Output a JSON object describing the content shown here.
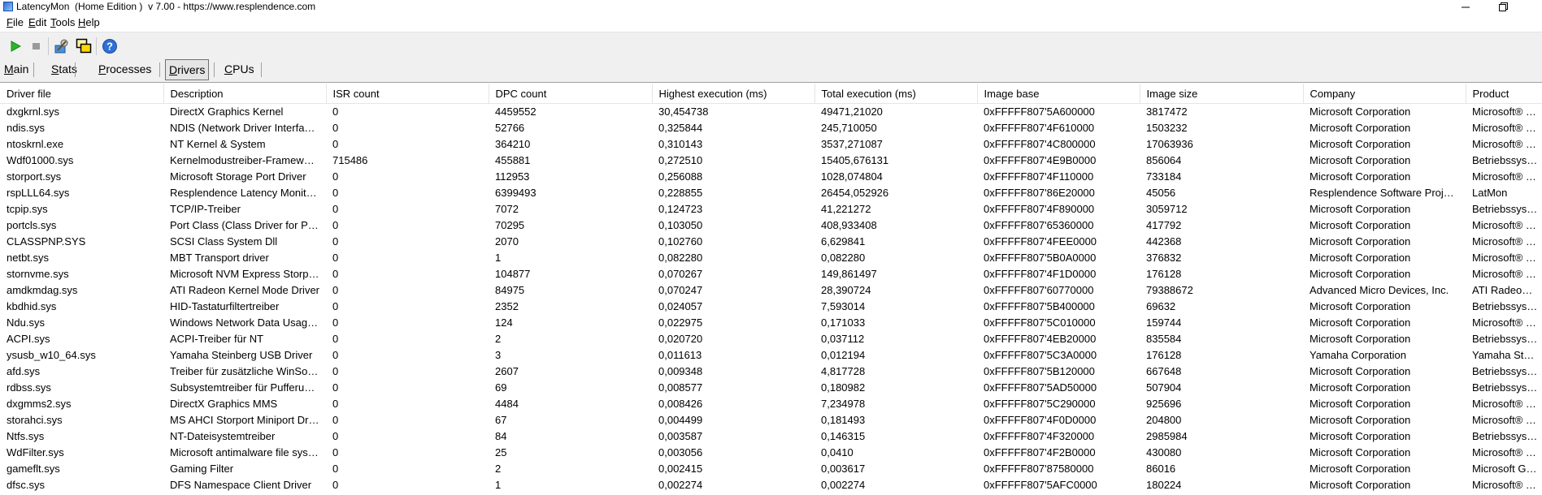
{
  "window": {
    "title": "LatencyMon  (Home Edition )  v 7.00 - https://www.resplendence.com"
  },
  "menu": [
    {
      "label": "File",
      "u": "F",
      "rest": "ile"
    },
    {
      "label": "Edit",
      "u": "E",
      "rest": "dit"
    },
    {
      "label": "Tools",
      "u": "T",
      "rest": "ools"
    },
    {
      "label": "Help",
      "u": "H",
      "rest": "elp"
    }
  ],
  "toolbar": {
    "icons": [
      "play-icon",
      "stop-icon",
      "driver-settings-icon",
      "windows-icon",
      "help-icon"
    ]
  },
  "tabs": [
    {
      "label": "Main",
      "u": "M",
      "rest": "ain",
      "active": false
    },
    {
      "label": "Stats",
      "u": "S",
      "rest": "tats",
      "active": false
    },
    {
      "label": "Processes",
      "u": "P",
      "rest": "rocesses",
      "active": false
    },
    {
      "label": "Drivers",
      "u": "D",
      "rest": "rivers",
      "active": true
    },
    {
      "label": "CPUs",
      "u": "C",
      "rest": "PUs",
      "active": false
    }
  ],
  "table": {
    "columns": [
      "Driver file",
      "Description",
      "ISR count",
      "DPC count",
      "Highest execution (ms)",
      "Total execution (ms)",
      "Image base",
      "Image size",
      "Company",
      "Product"
    ],
    "rows": [
      [
        "dxgkrnl.sys",
        "DirectX Graphics Kernel",
        "0",
        "4459552",
        "30,454738",
        "49471,21020",
        "0xFFFFF807'5A600000",
        "3817472",
        "Microsoft Corporation",
        "Microsoft® Wi"
      ],
      [
        "ndis.sys",
        "NDIS (Network Driver Interface Specification)",
        "0",
        "52766",
        "0,325844",
        "245,710050",
        "0xFFFFF807'4F610000",
        "1503232",
        "Microsoft Corporation",
        "Microsoft® Wi"
      ],
      [
        "ntoskrnl.exe",
        "NT Kernel & System",
        "0",
        "364210",
        "0,310143",
        "3537,271087",
        "0xFFFFF807'4C800000",
        "17063936",
        "Microsoft Corporation",
        "Microsoft® Wi"
      ],
      [
        "Wdf01000.sys",
        "Kernelmodustreiber-Framework-Laufzeit",
        "715486",
        "455881",
        "0,272510",
        "15405,676131",
        "0xFFFFF807'4E9B0000",
        "856064",
        "Microsoft Corporation",
        "Betriebssyster"
      ],
      [
        "storport.sys",
        "Microsoft Storage Port Driver",
        "0",
        "112953",
        "0,256088",
        "1028,074804",
        "0xFFFFF807'4F110000",
        "733184",
        "Microsoft Corporation",
        "Microsoft® Wi"
      ],
      [
        "rspLLL64.sys",
        "Resplendence Latency Monitoring and Auxiliary Kernel Library",
        "0",
        "6399493",
        "0,228855",
        "26454,052926",
        "0xFFFFF807'86E20000",
        "45056",
        "Resplendence Software Projects Sp.",
        "LatMon"
      ],
      [
        "tcpip.sys",
        "TCP/IP-Treiber",
        "0",
        "7072",
        "0,124723",
        "41,221272",
        "0xFFFFF807'4F890000",
        "3059712",
        "Microsoft Corporation",
        "Betriebssyster"
      ],
      [
        "portcls.sys",
        "Port Class (Class Driver for Port/Miniport Devices)",
        "0",
        "70295",
        "0,103050",
        "408,933408",
        "0xFFFFF807'65360000",
        "417792",
        "Microsoft Corporation",
        "Microsoft® Wi"
      ],
      [
        "CLASSPNP.SYS",
        "SCSI Class System Dll",
        "0",
        "2070",
        "0,102760",
        "6,629841",
        "0xFFFFF807'4FEE0000",
        "442368",
        "Microsoft Corporation",
        "Microsoft® Wi"
      ],
      [
        "netbt.sys",
        "MBT Transport driver",
        "0",
        "1",
        "0,082280",
        "0,082280",
        "0xFFFFF807'5B0A0000",
        "376832",
        "Microsoft Corporation",
        "Microsoft® Wi"
      ],
      [
        "stornvme.sys",
        "Microsoft NVM Express Storport Miniport Driver",
        "0",
        "104877",
        "0,070267",
        "149,861497",
        "0xFFFFF807'4F1D0000",
        "176128",
        "Microsoft Corporation",
        "Microsoft® Wi"
      ],
      [
        "amdkmdag.sys",
        "ATI Radeon Kernel Mode Driver",
        "0",
        "84975",
        "0,070247",
        "28,390724",
        "0xFFFFF807'60770000",
        "79388672",
        "Advanced Micro Devices, Inc.",
        "ATI Radeon Fa"
      ],
      [
        "kbdhid.sys",
        "HID-Tastaturfiltertreiber",
        "0",
        "2352",
        "0,024057",
        "7,593014",
        "0xFFFFF807'5B400000",
        "69632",
        "Microsoft Corporation",
        "Betriebssyster"
      ],
      [
        "Ndu.sys",
        "Windows Network Data Usage Monitoring Driver",
        "0",
        "124",
        "0,022975",
        "0,171033",
        "0xFFFFF807'5C010000",
        "159744",
        "Microsoft Corporation",
        "Microsoft® Wi"
      ],
      [
        "ACPI.sys",
        "ACPI-Treiber für NT",
        "0",
        "2",
        "0,020720",
        "0,037112",
        "0xFFFFF807'4EB20000",
        "835584",
        "Microsoft Corporation",
        "Betriebssyster"
      ],
      [
        "ysusb_w10_64.sys",
        "Yamaha Steinberg USB Driver",
        "0",
        "3",
        "0,011613",
        "0,012194",
        "0xFFFFF807'5C3A0000",
        "176128",
        "Yamaha Corporation",
        "Yamaha Steinb"
      ],
      [
        "afd.sys",
        "Treiber für zusätzliche WinSock-Funktionen",
        "0",
        "2607",
        "0,009348",
        "4,817728",
        "0xFFFFF807'5B120000",
        "667648",
        "Microsoft Corporation",
        "Betriebssyster"
      ],
      [
        "rdbss.sys",
        "Subsystemtreiber für Pufferung umgeleiteter Laufwerke",
        "0",
        "69",
        "0,008577",
        "0,180982",
        "0xFFFFF807'5AD50000",
        "507904",
        "Microsoft Corporation",
        "Betriebssyster"
      ],
      [
        "dxgmms2.sys",
        "DirectX Graphics MMS",
        "0",
        "4484",
        "0,008426",
        "7,234978",
        "0xFFFFF807'5C290000",
        "925696",
        "Microsoft Corporation",
        "Microsoft® Wi"
      ],
      [
        "storahci.sys",
        "MS AHCI Storport Miniport Driver",
        "0",
        "67",
        "0,004499",
        "0,181493",
        "0xFFFFF807'4F0D0000",
        "204800",
        "Microsoft Corporation",
        "Microsoft® Wi"
      ],
      [
        "Ntfs.sys",
        "NT-Dateisystemtreiber",
        "0",
        "84",
        "0,003587",
        "0,146315",
        "0xFFFFF807'4F320000",
        "2985984",
        "Microsoft Corporation",
        "Betriebssyster"
      ],
      [
        "WdFilter.sys",
        "Microsoft antimalware file system filter driver",
        "0",
        "25",
        "0,003056",
        "0,0410",
        "0xFFFFF807'4F2B0000",
        "430080",
        "Microsoft Corporation",
        "Microsoft® Wi"
      ],
      [
        "gameflt.sys",
        "Gaming Filter",
        "0",
        "2",
        "0,002415",
        "0,003617",
        "0xFFFFF807'87580000",
        "86016",
        "Microsoft Corporation",
        "Microsoft Gam"
      ],
      [
        "dfsc.sys",
        "DFS Namespace Client Driver",
        "0",
        "1",
        "0,002274",
        "0,002274",
        "0xFFFFF807'5AFC0000",
        "180224",
        "Microsoft Corporation",
        "Microsoft® Wi"
      ]
    ]
  }
}
